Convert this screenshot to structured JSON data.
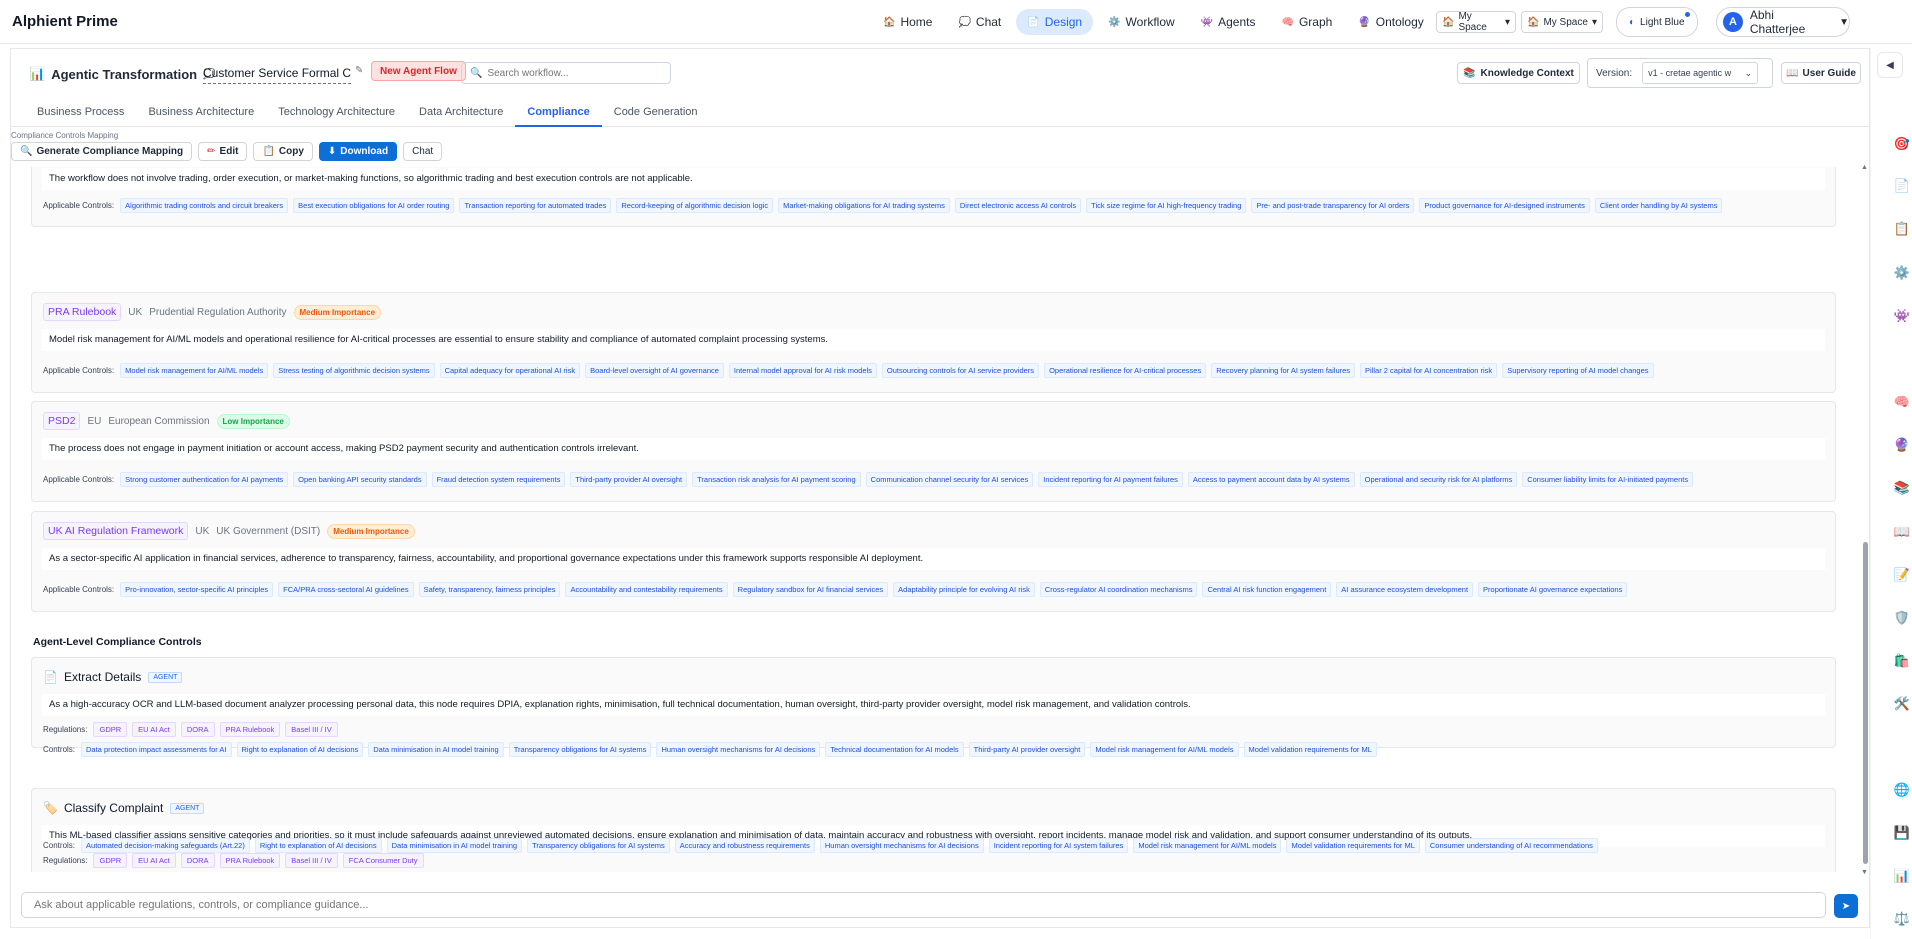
{
  "app": {
    "brand": "Alphient Prime"
  },
  "nav": [
    {
      "label": "Home",
      "icon": "🏠"
    },
    {
      "label": "Chat",
      "icon": "💭"
    },
    {
      "label": "Design",
      "icon": "📄",
      "active": true
    },
    {
      "label": "Workflow",
      "icon": "⚙️"
    },
    {
      "label": "Agents",
      "icon": "👾"
    },
    {
      "label": "Graph",
      "icon": "🧠"
    },
    {
      "label": "Ontology",
      "icon": "🔮"
    }
  ],
  "spaces": [
    "My Space",
    "My Space"
  ],
  "theme": {
    "label": "Light Blue"
  },
  "user": {
    "initial": "A",
    "name": "Abhi Chatterjee"
  },
  "header": {
    "project": "Agentic Transformation",
    "workflow_value": "Customer Service Formal Co",
    "new_flow": "New Agent Flow",
    "search_placeholder": "Search workflow...",
    "knowledge": "Knowledge Context",
    "version_label": "Version:",
    "version_value": "v1 - cretae agentic w",
    "guide": "User Guide"
  },
  "tabs": [
    "Business Process",
    "Business Architecture",
    "Technology Architecture",
    "Data Architecture",
    "Compliance",
    "Code Generation"
  ],
  "active_tab": 4,
  "compliance_label": "Compliance Controls Mapping",
  "toolbar": {
    "generate": "Generate Compliance Mapping",
    "edit": "Edit",
    "copy": "Copy",
    "download": "Download",
    "chat": "Chat"
  },
  "applicable_label": "Applicable Controls:",
  "regulations_label": "Regulations:",
  "controls_label": "Controls:",
  "partial_card": {
    "desc": "The workflow does not involve trading, order execution, or market-making functions, so algorithmic trading and best execution controls are not applicable.",
    "controls": [
      "Algorithmic trading controls and circuit breakers",
      "Best execution obligations for AI order routing",
      "Transaction reporting for automated trades",
      "Record-keeping of algorithmic decision logic",
      "Market-making obligations for AI trading systems",
      "Direct electronic access AI controls",
      "Tick size regime for AI high-frequency trading",
      "Pre- and post-trade transparency for AI orders",
      "Product governance for AI-designed instruments",
      "Client order handling by AI systems"
    ]
  },
  "reg_cards": [
    {
      "name": "PRA Rulebook",
      "region": "UK",
      "authority": "Prudential Regulation Authority",
      "importance": "Medium Importance",
      "level": "medium",
      "desc": "Model risk management for AI/ML models and operational resilience for AI-critical processes are essential to ensure stability and compliance of automated complaint processing systems.",
      "controls": [
        "Model risk management for AI/ML models",
        "Stress testing of algorithmic decision systems",
        "Capital adequacy for operational AI risk",
        "Board-level oversight of AI governance",
        "Internal model approval for AI risk models",
        "Outsourcing controls for AI service providers",
        "Operational resilience for AI-critical processes",
        "Recovery planning for AI system failures",
        "Pillar 2 capital for AI concentration risk",
        "Supervisory reporting of AI model changes"
      ]
    },
    {
      "name": "PSD2",
      "region": "EU",
      "authority": "European Commission",
      "importance": "Low Importance",
      "level": "low",
      "desc": "The process does not engage in payment initiation or account access, making PSD2 payment security and authentication controls irrelevant.",
      "controls": [
        "Strong customer authentication for AI payments",
        "Open banking API security standards",
        "Fraud detection system requirements",
        "Third-party provider AI oversight",
        "Transaction risk analysis for AI payment scoring",
        "Communication channel security for AI services",
        "Incident reporting for AI payment failures",
        "Access to payment account data by AI systems",
        "Operational and security risk for AI platforms",
        "Consumer liability limits for AI-initiated payments"
      ]
    },
    {
      "name": "UK AI Regulation Framework",
      "region": "UK",
      "authority": "UK Government (DSIT)",
      "importance": "Medium Importance",
      "level": "medium",
      "desc": "As a sector-specific AI application in financial services, adherence to transparency, fairness, accountability, and proportional governance expectations under this framework supports responsible AI deployment.",
      "controls": [
        "Pro-innovation, sector-specific AI principles",
        "FCA/PRA cross-sectoral AI guidelines",
        "Safety, transparency, fairness principles",
        "Accountability and contestability requirements",
        "Regulatory sandbox for AI financial services",
        "Adaptability principle for evolving AI risk",
        "Cross-regulator AI coordination mechanisms",
        "Central AI risk function engagement",
        "AI assurance ecosystem development",
        "Proportionate AI governance expectations"
      ]
    }
  ],
  "agent_section_title": "Agent-Level Compliance Controls",
  "agents": [
    {
      "name": "Extract Details",
      "icon": "📄",
      "badge": "AGENT",
      "desc": "As a high-accuracy OCR and LLM-based document analyzer processing personal data, this node requires DPIA, explanation rights, minimisation, full technical documentation, human oversight, third-party provider oversight, model risk management, and validation controls.",
      "regulations": [
        "GDPR",
        "EU AI Act",
        "DORA",
        "PRA Rulebook",
        "Basel III / IV"
      ],
      "controls": [
        "Data protection impact assessments for AI",
        "Right to explanation of AI decisions",
        "Data minimisation in AI model training",
        "Transparency obligations for AI systems",
        "Human oversight mechanisms for AI decisions",
        "Technical documentation for AI models",
        "Third-party AI provider oversight",
        "Model risk management for AI/ML models",
        "Model validation requirements for ML"
      ]
    },
    {
      "name": "Classify Complaint",
      "icon": "🏷️",
      "badge": "AGENT",
      "desc": "This ML-based classifier assigns sensitive categories and priorities, so it must include safeguards against unreviewed automated decisions, ensure explanation and minimisation of data, maintain accuracy and robustness with oversight, report incidents, manage model risk and validation, and support consumer understanding of its outputs.",
      "regulations": [
        "GDPR",
        "EU AI Act",
        "DORA",
        "PRA Rulebook",
        "Basel III / IV",
        "FCA Consumer Duty"
      ],
      "controls": [
        "Automated decision-making safeguards (Art.22)",
        "Right to explanation of AI decisions",
        "Data minimisation in AI model training",
        "Transparency obligations for AI systems",
        "Accuracy and robustness requirements",
        "Human oversight mechanisms for AI decisions",
        "Incident reporting for AI system failures",
        "Model risk management for AI/ML models",
        "Model validation requirements for ML",
        "Consumer understanding of AI recommendations"
      ]
    }
  ],
  "chat": {
    "placeholder": "Ask about applicable regulations, controls, or compliance guidance..."
  },
  "rail_icons": [
    "target-icon",
    "document-icon",
    "clipboard-icon",
    "gear-icon",
    "robot-icon",
    "brain-icon",
    "crystal-ball-icon",
    "stack-icon",
    "book-icon",
    "memo-icon",
    "shield-icon",
    "bag-icon",
    "tools-icon",
    "globe-icon",
    "save-icon",
    "chart-icon",
    "scale-icon"
  ]
}
